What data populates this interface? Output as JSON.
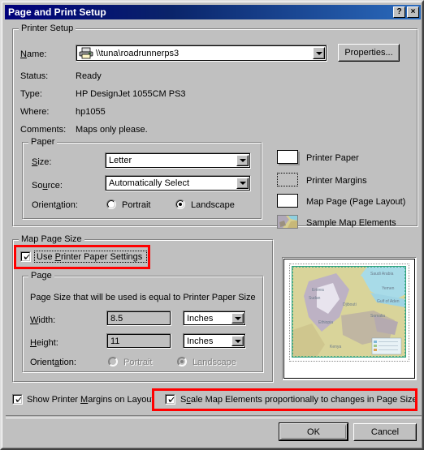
{
  "window": {
    "title": "Page and Print Setup",
    "help_button": "?",
    "close_button": "×"
  },
  "printer_setup": {
    "legend": "Printer Setup",
    "name_label": "Name:",
    "name_value": "\\\\tuna\\roadrunnerps3",
    "properties_button": "Properties...",
    "status_label": "Status:",
    "status_value": "Ready",
    "type_label": "Type:",
    "type_value": "HP DesignJet 1055CM PS3",
    "where_label": "Where:",
    "where_value": "hp1055",
    "comments_label": "Comments:",
    "comments_value": "Maps only please."
  },
  "paper": {
    "legend": "Paper",
    "size_label": "Size:",
    "size_value": "Letter",
    "source_label": "Source:",
    "source_value": "Automatically Select",
    "orientation_label": "Orientation:",
    "portrait_label": "Portrait",
    "landscape_label": "Landscape",
    "selected_orientation": "Landscape"
  },
  "legend_items": [
    {
      "label": "Printer Paper",
      "icon": "white-rect-swatch"
    },
    {
      "label": "Printer Margins",
      "icon": "dotted-rect-swatch"
    },
    {
      "label": "Map Page (Page Layout)",
      "icon": "white-rect-swatch"
    },
    {
      "label": "Sample Map Elements",
      "icon": "map-thumbnail-swatch"
    }
  ],
  "map_page_size": {
    "legend": "Map Page Size",
    "use_printer_paper_label": "Use Printer Paper Settings",
    "use_printer_paper_checked": true,
    "page": {
      "legend": "Page",
      "description": "Page Size that will be used is equal to Printer Paper Size",
      "width_label": "Width:",
      "width_value": "8.5",
      "width_units": "Inches",
      "height_label": "Height:",
      "height_value": "11",
      "height_units": "Inches",
      "orientation_label": "Orientation:",
      "portrait_label": "Portrait",
      "landscape_label": "Landscape",
      "selected_orientation": "Landscape",
      "disabled": true
    }
  },
  "footer": {
    "show_margins_label": "Show Printer Margins on Layout",
    "show_margins_checked": true,
    "scale_elements_label": "Scale Map Elements proportionally to changes in Page Size",
    "scale_elements_checked": true,
    "ok_button": "OK",
    "cancel_button": "Cancel"
  },
  "colors": {
    "highlight": "#ff0000",
    "titlebar_start": "#00007b",
    "titlebar_end": "#2b6bbd",
    "face": "#c0c0c0"
  }
}
